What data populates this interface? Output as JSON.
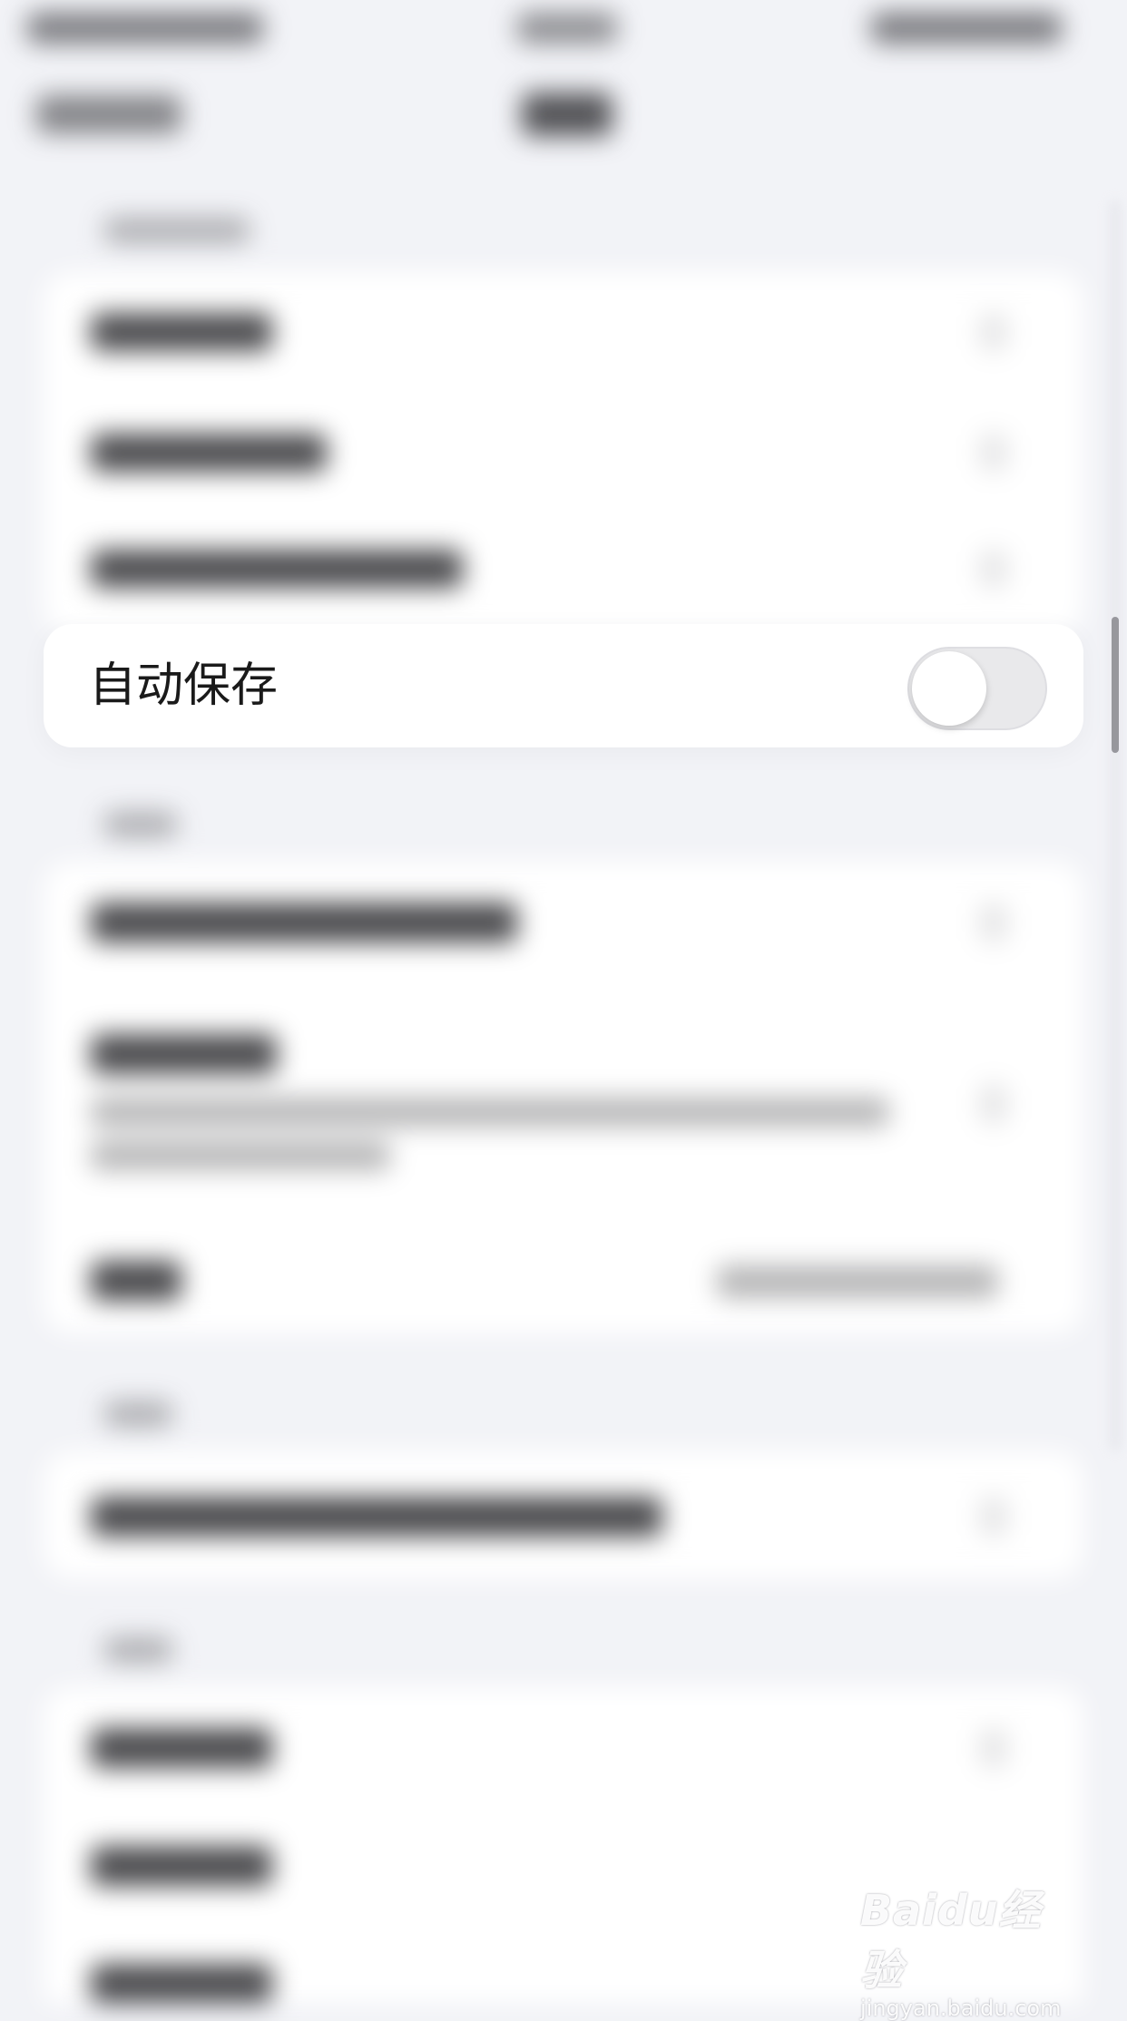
{
  "focused_setting": {
    "label": "自动保存",
    "toggle_state": "off"
  },
  "watermark": {
    "logo": "Baidu经验",
    "url": "jingyan.baidu.com"
  }
}
